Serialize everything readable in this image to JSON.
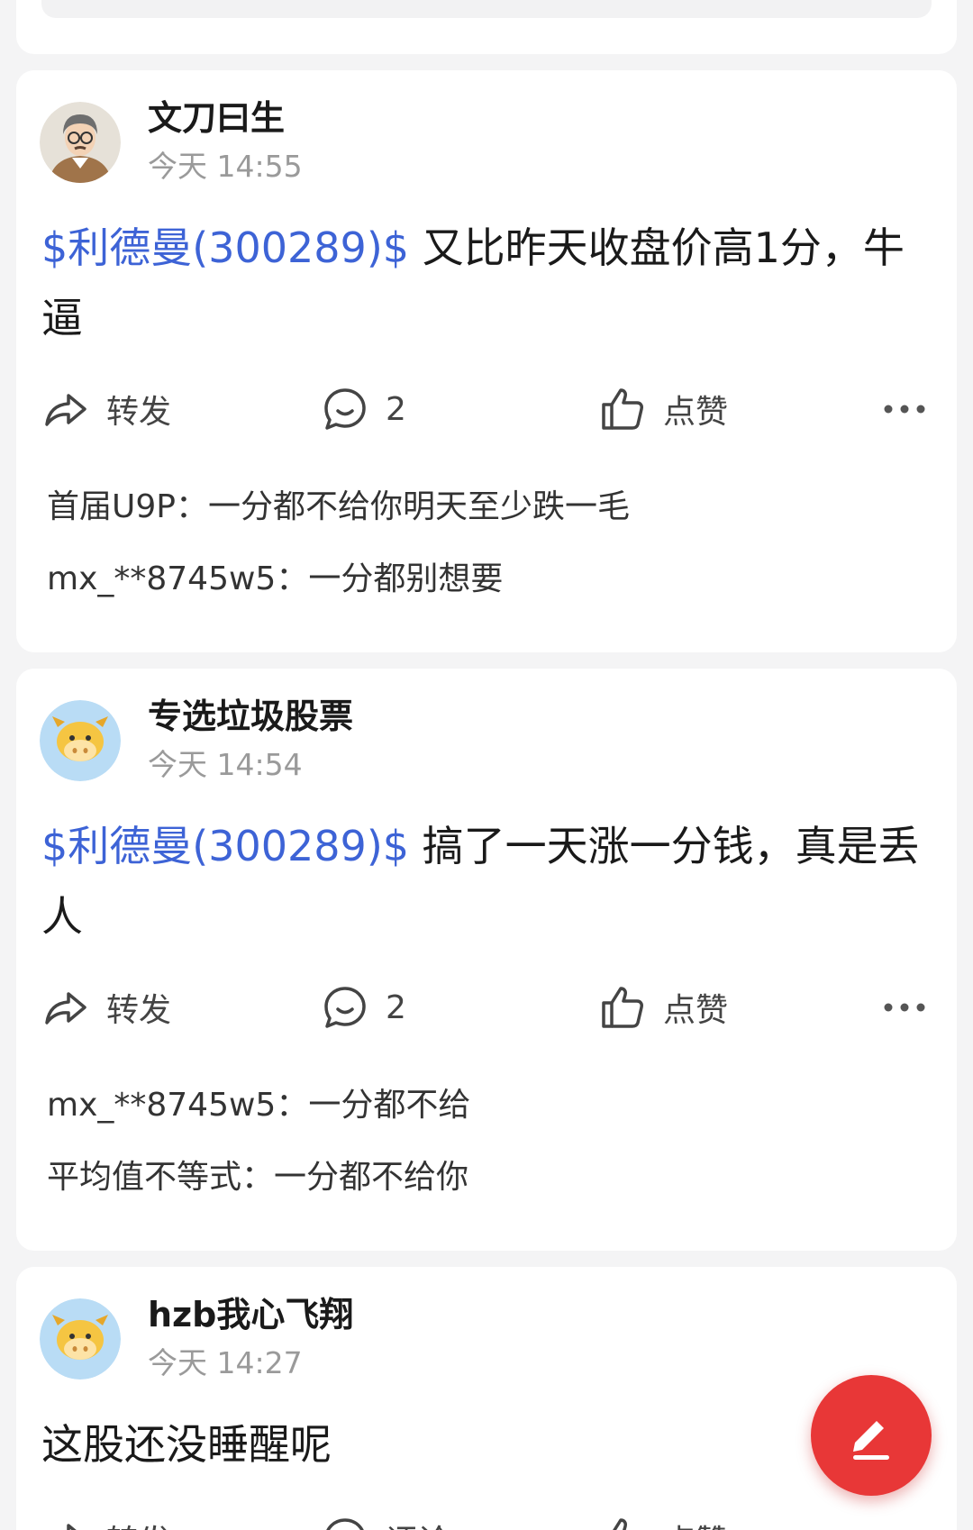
{
  "posts": [
    {
      "username": "文刀曰生",
      "time": "今天 14:55",
      "stock": "$利德曼(300289)$",
      "text": " 又比昨天收盘价高1分，牛逼",
      "actions": {
        "share": "转发",
        "comment": "2",
        "like": "点赞"
      },
      "comments": [
        {
          "name": "首届U9P：",
          "text": "一分都不给你明天至少跌一毛"
        },
        {
          "name": "mx_**8745w5：",
          "text": "一分都别想要"
        }
      ]
    },
    {
      "username": "专选垃圾股票",
      "time": "今天 14:54",
      "stock": "$利德曼(300289)$",
      "text": " 搞了一天涨一分钱，真是丢人",
      "actions": {
        "share": "转发",
        "comment": "2",
        "like": "点赞"
      },
      "comments": [
        {
          "name": "mx_**8745w5：",
          "text": "一分都不给"
        },
        {
          "name": "平均值不等式：",
          "text": "一分都不给你"
        }
      ]
    },
    {
      "username": "hzb我心飞翔",
      "time": "今天 14:27",
      "text": "这股还没睡醒呢",
      "actions": {
        "share": "转发",
        "comment": "评论",
        "like": "点赞"
      }
    }
  ],
  "colors": {
    "stock_link": "#3d63d6",
    "fab": "#e83737",
    "time": "#9a9a9a"
  },
  "icons": {
    "share": "share-arrow-icon",
    "comment": "comment-bubble-icon",
    "like": "thumbs-up-icon",
    "more": "more-dots-icon",
    "fab": "pencil-edit-icon"
  }
}
